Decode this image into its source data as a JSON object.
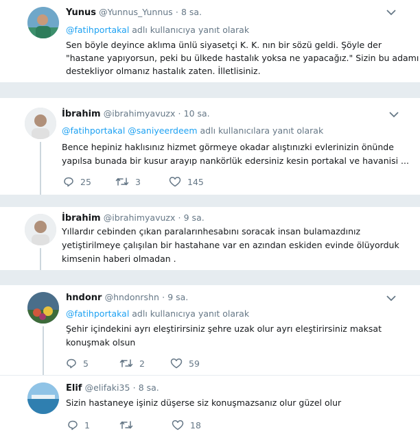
{
  "tweets": [
    {
      "name": "Yunus",
      "handle": "@Yunnus_Yunnus",
      "sep": "·",
      "time": "8 sa.",
      "reply_mentions": "@fatihportakal",
      "reply_suffix": " adlı kullanıcıya yanıt olarak",
      "lines": [
        "Sen böyle deyince aklıma ünlü siyasetçi K. K. nın bir sözü geldi. Şöyle der",
        "\"hastane yapıyorsun, peki bu ülkede hastalık yoksa ne yapacağız.\" Sizin bu adamı",
        "destekliyor olmanız hastalık zaten. İlletlisiniz."
      ]
    },
    {
      "name": "İbrahim",
      "handle": "@ibrahimyavuzx",
      "sep": "·",
      "time": "10 sa.",
      "reply_mentions": "@fatihportakal @saniyeerdeem",
      "reply_suffix": " adlı kullanıcılara yanıt olarak",
      "lines": [
        "Bence hepiniz haklısınız hizmet görmeye okadar alıştınızki evlerinizin önünde",
        "yapılsa bunada bir kusur arayıp nankörlük edersiniz kesin portakal ve havanisi ..."
      ],
      "replies": "25",
      "retweets": "3",
      "likes": "145"
    },
    {
      "name": "İbrahim",
      "handle": "@ibrahimyavuzx",
      "sep": "·",
      "time": "9 sa.",
      "lines": [
        "Yıllardır cebinden çıkan paralarınhesabını soracak insan bulamazdınız",
        "yetiştirilmeye çalışılan bir hastahane var en azından eskiden evinde ölüyorduk",
        "kimsenin haberi olmadan ."
      ]
    },
    {
      "name": "hndonr",
      "handle": "@hndonrshn",
      "sep": "·",
      "time": "9 sa.",
      "reply_mentions": "@fatihportakal",
      "reply_suffix": " adlı kullanıcıya yanıt olarak",
      "lines": [
        "Şehir içindekini ayrı eleştirirsiniz şehre uzak olur ayrı eleştirirsiniz maksat",
        "konuşmak olsun"
      ],
      "replies": "5",
      "retweets": "2",
      "likes": "59"
    },
    {
      "name": "Elif",
      "handle": "@elifaki35",
      "sep": "·",
      "time": "8 sa.",
      "lines": [
        "Sizin hastaneye işiniz düşerse siz konuşmazsanız olur güzel olur"
      ],
      "replies": "1",
      "retweets": "",
      "likes": "18"
    }
  ],
  "colors": {
    "mention": "#1da1f2",
    "muted": "#657786",
    "background": "#e6ecf0",
    "thread_line": "#ccd6dd"
  },
  "icons": [
    "reply-icon",
    "retweet-icon",
    "like-icon",
    "chevron-down-icon"
  ]
}
